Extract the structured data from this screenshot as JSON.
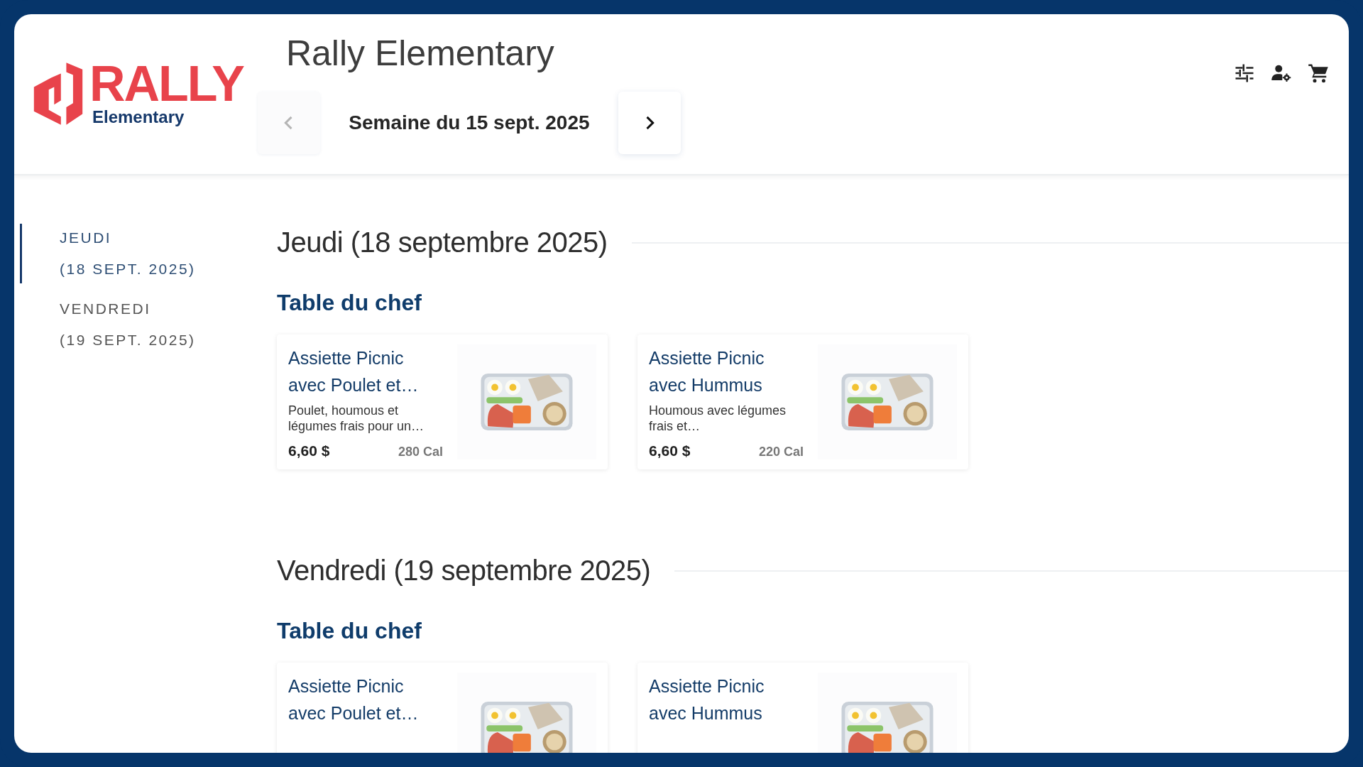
{
  "logo": {
    "wordmark": "RALLY",
    "subtitle": "Elementary"
  },
  "header": {
    "title": "Rally Elementary",
    "week": "Semaine du 15 sept. 2025",
    "nav": [
      {
        "kind": "prev",
        "disabled": true
      },
      {
        "kind": "next",
        "disabled": false
      }
    ]
  },
  "toolbar": [
    {
      "kind": "filter"
    },
    {
      "kind": "account"
    },
    {
      "kind": "cart"
    }
  ],
  "sidebar": {
    "items": [
      {
        "day": "JEUDI",
        "date": "(18 SEPT. 2025)",
        "selected": true
      },
      {
        "day": "VENDREDI",
        "date": "(19 SEPT. 2025)",
        "selected": false
      }
    ]
  },
  "days": [
    {
      "title": "Jeudi (18 septembre 2025)",
      "sections": [
        {
          "title": "Table du chef",
          "items": [
            {
              "name": "Assiette Picnic avec Poulet et…",
              "description": "Poulet, houmous et légumes frais pour un…",
              "price": "6,60 $",
              "calories": "280 Cal"
            },
            {
              "name": "Assiette Picnic avec Hummus",
              "description": "Houmous avec légumes frais et…",
              "price": "6,60 $",
              "calories": "220 Cal"
            }
          ]
        }
      ]
    },
    {
      "title": "Vendredi (19 septembre 2025)",
      "sections": [
        {
          "title": "Table du chef",
          "items": [
            {
              "name": "Assiette Picnic avec Poulet et…"
            },
            {
              "name": "Assiette Picnic avec Hummus"
            }
          ]
        }
      ]
    }
  ]
}
